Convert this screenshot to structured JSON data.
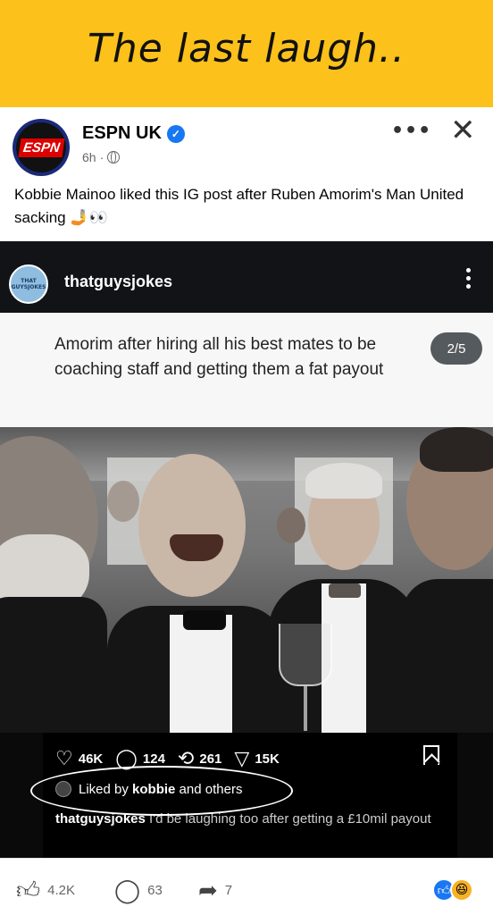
{
  "meme": {
    "title": "The last laugh.."
  },
  "post": {
    "page_name": "ESPN UK",
    "logo_text": "ESPN",
    "time": "6h",
    "time_separator": "·",
    "caption": "Kobbie Mainoo liked this IG post after Ruben Amorim's Man United sacking 🤳👀",
    "more_icon": "•••",
    "close_icon": "✕"
  },
  "ig": {
    "avatar_text": "THAT GUYSJOKES",
    "username": "thatguysjokes",
    "tweet_text": "Amorim after hiring all his best mates to be coaching staff and getting them a fat payout",
    "page_counter": "2/5",
    "likes": "46K",
    "comments": "124",
    "reposts": "261",
    "shares": "15K",
    "liked_by_prefix": "Liked by ",
    "liked_by_user": "kobbie",
    "liked_by_suffix": " and others",
    "caption_user": "thatguysjokes",
    "caption_text": " I'd be laughing too after getting a £10mil payout"
  },
  "footer": {
    "likes": "4.2K",
    "comments": "63",
    "shares": "7"
  },
  "colors": {
    "banner": "#fcc11a",
    "fb_blue": "#1877f2",
    "ig_dark": "#121316"
  }
}
